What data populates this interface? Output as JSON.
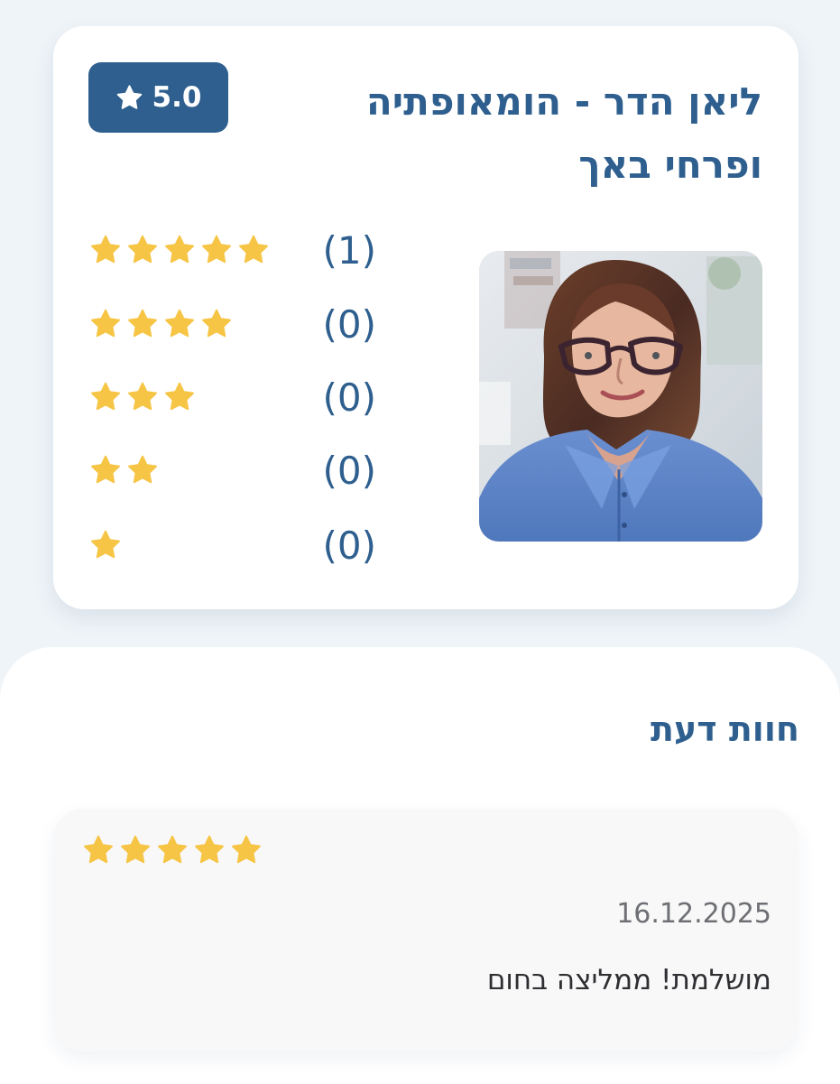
{
  "profile": {
    "name": "ליאן הדר - הומאופתיה ופרחי באך",
    "rating_badge": {
      "icon": "star-icon",
      "value": "5.0"
    },
    "photo": {
      "alt": "ליאן הדר - הומאופתיה ופרחי באך"
    },
    "rating_distribution": [
      {
        "stars": 5,
        "count_label": "(1)"
      },
      {
        "stars": 4,
        "count_label": "(0)"
      },
      {
        "stars": 3,
        "count_label": "(0)"
      },
      {
        "stars": 2,
        "count_label": "(0)"
      },
      {
        "stars": 1,
        "count_label": "(0)"
      }
    ]
  },
  "reviews": {
    "title": "חוות דעת",
    "items": [
      {
        "stars": 5,
        "date": "16.12.2025",
        "text": "מושלמת! ממליצה בחום"
      }
    ]
  },
  "colors": {
    "background": "#eff4f8",
    "card": "#ffffff",
    "accent": "#2e5f8e",
    "star": "#f7c545",
    "review_card": "#f8f8f9",
    "muted_text": "#6d6f73",
    "body_text": "#2f2f33"
  }
}
